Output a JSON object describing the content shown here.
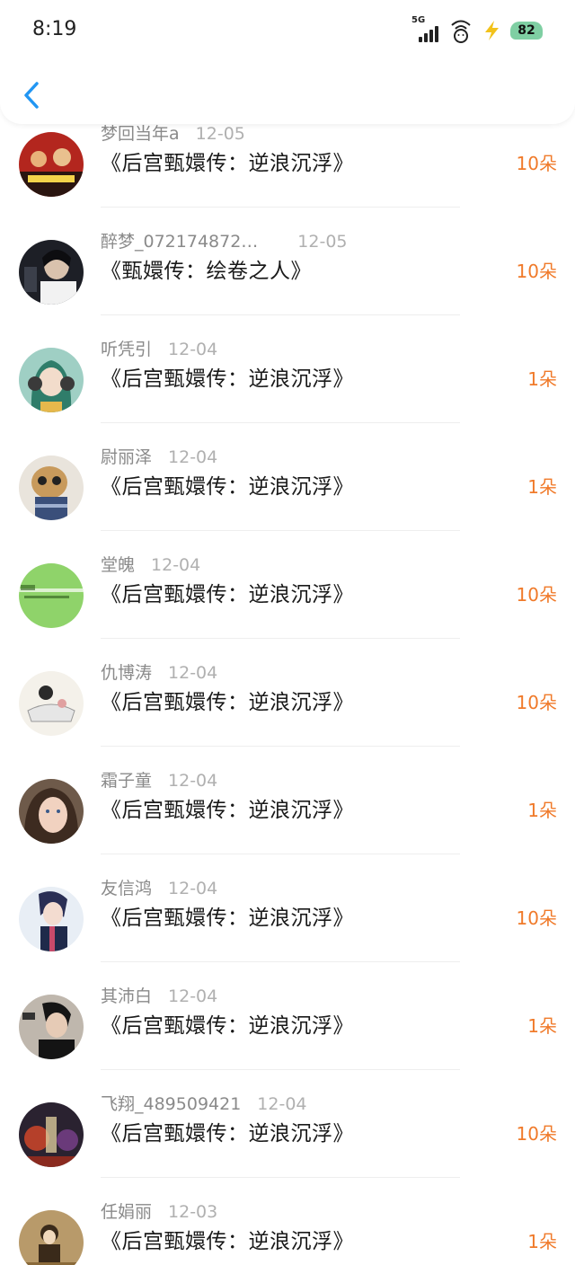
{
  "status_bar": {
    "time": "8:19",
    "network": "5G",
    "battery": "82"
  },
  "header": {
    "back_icon": "chevron-left-icon",
    "accent_color": "#2196f3"
  },
  "colors": {
    "amount": "#f07a2a",
    "title": "#1a1a1a",
    "username": "#8a8a8a",
    "date": "#b0b0b0"
  },
  "list": [
    {
      "user": "梦回当年a",
      "date": "12-05",
      "title": "《后宫甄嬛传：逆浪沉浮》",
      "amount": "10朵"
    },
    {
      "user": "醉梦_072174872…",
      "date": "12-05",
      "title": "《甄嬛传：绘卷之人》",
      "amount": "10朵"
    },
    {
      "user": "听凭引",
      "date": "12-04",
      "title": "《后宫甄嬛传：逆浪沉浮》",
      "amount": "1朵"
    },
    {
      "user": "尉丽泽",
      "date": "12-04",
      "title": "《后宫甄嬛传：逆浪沉浮》",
      "amount": "1朵"
    },
    {
      "user": "堂魄",
      "date": "12-04",
      "title": "《后宫甄嬛传：逆浪沉浮》",
      "amount": "10朵"
    },
    {
      "user": "仇博涛",
      "date": "12-04",
      "title": "《后宫甄嬛传：逆浪沉浮》",
      "amount": "10朵"
    },
    {
      "user": "霜子童",
      "date": "12-04",
      "title": "《后宫甄嬛传：逆浪沉浮》",
      "amount": "1朵"
    },
    {
      "user": "友信鸿",
      "date": "12-04",
      "title": "《后宫甄嬛传：逆浪沉浮》",
      "amount": "10朵"
    },
    {
      "user": "其沛白",
      "date": "12-04",
      "title": "《后宫甄嬛传：逆浪沉浮》",
      "amount": "1朵"
    },
    {
      "user": "飞翔_489509421",
      "date": "12-04",
      "title": "《后宫甄嬛传：逆浪沉浮》",
      "amount": "10朵"
    },
    {
      "user": "任娟丽",
      "date": "12-03",
      "title": "《后宫甄嬛传：逆浪沉浮》",
      "amount": "1朵"
    }
  ]
}
